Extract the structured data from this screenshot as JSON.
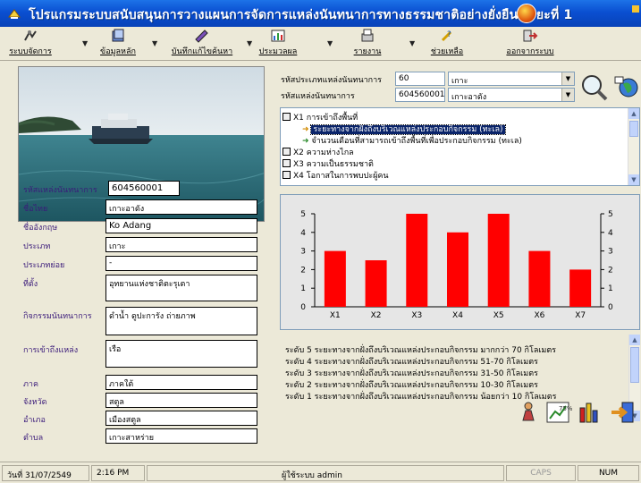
{
  "window": {
    "title": "โปรแกรมระบบสนับสนุนการวางแผนการจัดการแหล่งนันทนาการทางธรรมชาติอย่างยั่งยืน ระยะที่ 1"
  },
  "toolbar": {
    "items": [
      {
        "label": "ระบบจัดการ",
        "icon": "system-icon"
      },
      {
        "label": "ข้อมูลหลัก",
        "icon": "database-icon"
      },
      {
        "label": "บันทึกแก้ไขค้นหา",
        "icon": "edit-icon"
      },
      {
        "label": "ประมวลผล",
        "icon": "process-icon"
      },
      {
        "label": "รายงาน",
        "icon": "report-icon"
      },
      {
        "label": "ช่วยเหลือ",
        "icon": "help-icon"
      },
      {
        "label": "ออกจากระบบ",
        "icon": "exit-icon"
      }
    ]
  },
  "record": {
    "id_label": "รหัสแหล่งนันทนาการ",
    "id_value": "604560001",
    "fields": [
      {
        "label": "ชื่อไทย",
        "value": "เกาะอาดัง"
      },
      {
        "label": "ชื่ออังกฤษ",
        "value": "Ko Adang"
      },
      {
        "label": "ประเภท",
        "value": "เกาะ"
      },
      {
        "label": "ประเภทย่อย",
        "value": "-"
      },
      {
        "label": "ที่ตั้ง",
        "value": "อุทยานแห่งชาติตะรุเตา"
      },
      {
        "label": "กิจกรรมนันทนาการ",
        "value": "ดำน้ำ ดูปะการัง ถ่ายภาพ"
      },
      {
        "label": "การเข้าถึงแหล่ง",
        "value": "เรือ"
      },
      {
        "label": "ภาค",
        "value": "ภาคใต้"
      },
      {
        "label": "จังหวัด",
        "value": "สตูล"
      },
      {
        "label": "อำเภอ",
        "value": "เมืองสตูล"
      },
      {
        "label": "ตำบล",
        "value": "เกาะสาหร่าย"
      }
    ]
  },
  "selectors": {
    "type_label": "รหัสประเภทแหล่งนันทนาการ",
    "type_code": "60",
    "type_name": "เกาะ",
    "site_label": "รหัสแหล่งนันทนาการ",
    "site_code": "604560001",
    "site_name": "เกาะอาดัง"
  },
  "tree": {
    "items": [
      {
        "text": "X1 การเข้าถึงพื้นที่",
        "level": 0
      },
      {
        "text": "ระยะทางจากฝั่งถึงบริเวณแหล่งประกอบกิจกรรม (ทะเล)",
        "level": 1,
        "selected": true
      },
      {
        "text": "จำนวนเดือนที่สามารถเข้าถึงพื้นที่เพื่อประกอบกิจกรรม (ทะเล)",
        "level": 1
      },
      {
        "text": "X2 ความห่างไกล",
        "level": 0
      },
      {
        "text": "X3 ความเป็นธรรมชาติ",
        "level": 0
      },
      {
        "text": "X4 โอกาสในการพบปะผู้คน",
        "level": 0
      }
    ]
  },
  "chart_data": {
    "type": "bar",
    "categories": [
      "X1",
      "X2",
      "X3",
      "X4",
      "X5",
      "X6",
      "X7"
    ],
    "values": [
      3,
      2.5,
      5,
      4,
      5,
      3,
      2
    ],
    "ylim": [
      0,
      5
    ],
    "yticks": [
      "0",
      "1",
      "2",
      "3",
      "4",
      "5"
    ],
    "bar_color": "#ff0000",
    "title": "",
    "xlabel": "",
    "ylabel": "",
    "grid": false
  },
  "legend": {
    "lines": [
      "ระดับ 5 ระยะทางจากฝั่งถึงบริเวณแหล่งประกอบกิจกรรม มากกว่า 70 กิโลเมตร",
      "ระดับ 4 ระยะทางจากฝั่งถึงบริเวณแหล่งประกอบกิจกรรม 51-70 กิโลเมตร",
      "ระดับ 3 ระยะทางจากฝั่งถึงบริเวณแหล่งประกอบกิจกรรม 31-50 กิโลเมตร",
      "ระดับ 2 ระยะทางจากฝั่งถึงบริเวณแหล่งประกอบกิจกรรม 10-30 กิโลเมตร",
      "ระดับ 1 ระยะทางจากฝั่งถึงบริเวณแหล่งประกอบกิจกรรม น้อยกว่า 10 กิโลเมตร"
    ]
  },
  "status": {
    "date": "วันที่ 31/07/2549",
    "time": "2:16 PM",
    "user": "ผู้ใช้ระบบ admin",
    "caps": "CAPS",
    "num": "NUM"
  },
  "colors": {
    "titlebar": "#0a4fd1",
    "label_text": "#3a1a7a",
    "bar": "#ff0000",
    "selection": "#0a246a"
  }
}
